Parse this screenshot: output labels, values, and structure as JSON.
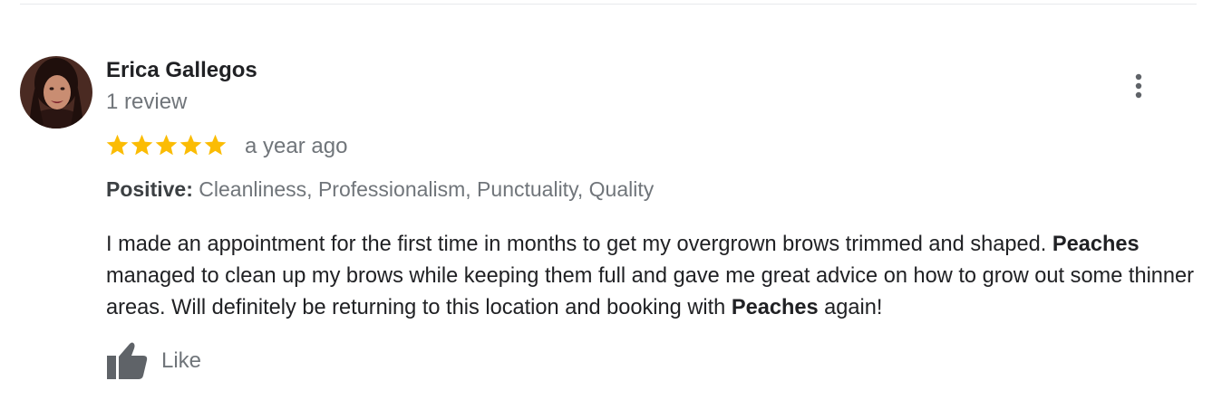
{
  "review": {
    "reviewer_name": "Erica Gallegos",
    "review_count": "1 review",
    "rating": 5,
    "rating_max": 5,
    "time_ago": "a year ago",
    "positive_label": "Positive:",
    "positive_tags": "Cleanliness, Professionalism, Punctuality, Quality",
    "text_parts": [
      "I made an appointment for the first time in months to get my overgrown brows trimmed and shaped. ",
      "Peaches",
      " managed to clean up my brows while keeping them full and gave me great advice on how to grow out some thinner areas. Will definitely be returning to this location and booking with ",
      "Peaches",
      " again!"
    ],
    "like_label": "Like"
  },
  "icons": {
    "avatar": "avatar",
    "more": "more-vert-icon",
    "star": "star-icon",
    "like": "thumbs-up-icon"
  },
  "colors": {
    "star": "#fbbc04",
    "secondary_text": "#70757a",
    "primary_text": "#202124",
    "icon": "#5f6368"
  }
}
